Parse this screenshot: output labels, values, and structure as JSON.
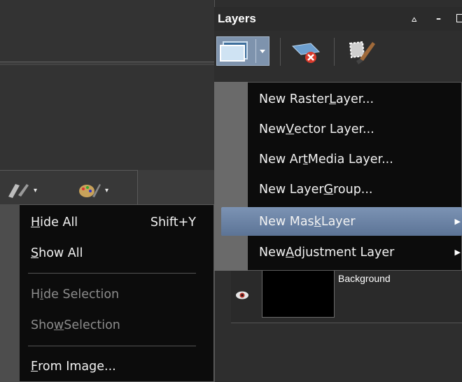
{
  "layers_panel": {
    "title": "Layers",
    "pin_glyph": "⩟",
    "minimize_glyph": "–"
  },
  "layer_list": {
    "layer_name": "Background"
  },
  "layer_menu": {
    "items": [
      {
        "pre": "New Raster ",
        "u": "L",
        "post": "ayer...",
        "submenu": false
      },
      {
        "pre": "New ",
        "u": "V",
        "post": "ector Layer...",
        "submenu": false
      },
      {
        "pre": "New Ar",
        "u": "t",
        "post": " Media Layer...",
        "submenu": false
      },
      {
        "pre": "New Layer ",
        "u": "G",
        "post": "roup...",
        "submenu": false
      },
      {
        "pre": "New Mas",
        "u": "k",
        "post": " Layer",
        "submenu": true,
        "highlighted": true
      },
      {
        "pre": "New ",
        "u": "A",
        "post": "djustment Layer",
        "submenu": true
      }
    ],
    "submenu_arrow": "▶"
  },
  "vis_menu": {
    "items": [
      {
        "pre": "",
        "u": "H",
        "post": "ide All",
        "shortcut": "Shift+Y",
        "disabled": false
      },
      {
        "pre": "",
        "u": "S",
        "post": "how All",
        "shortcut": "",
        "disabled": false
      },
      {
        "pre": "H",
        "u": "i",
        "post": "de Selection",
        "shortcut": "",
        "disabled": true
      },
      {
        "pre": "Sho",
        "u": "w",
        "post": " Selection",
        "shortcut": "",
        "disabled": true
      },
      {
        "pre": "",
        "u": "F",
        "post": "rom Image...",
        "shortcut": "",
        "disabled": false
      }
    ]
  },
  "toolbar": {
    "caret": "▾"
  },
  "colors": {
    "highlight": "#6a82a6",
    "menu_bg": "#0c0c0c",
    "panel_bg": "#2e2e2e"
  }
}
